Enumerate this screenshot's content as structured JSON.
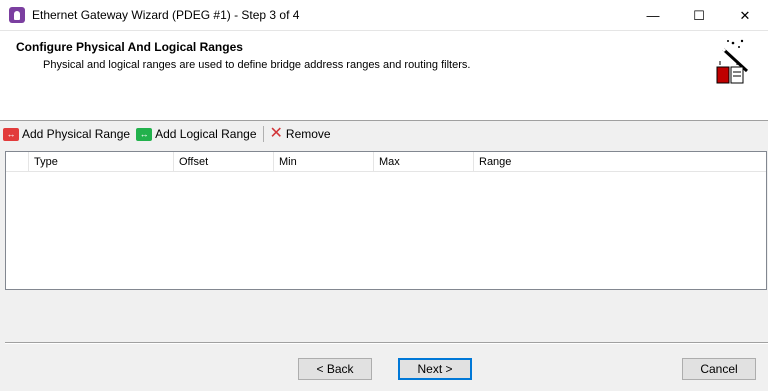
{
  "window": {
    "title": "Ethernet Gateway Wizard (PDEG #1) - Step 3 of 4",
    "minimize_glyph": "—",
    "maximize_glyph": "☐",
    "close_glyph": "✕"
  },
  "header": {
    "title": "Configure Physical And Logical Ranges",
    "description": "Physical and logical ranges are used to define bridge address ranges and routing filters.",
    "icon": "wizard-wand-icon"
  },
  "toolbar": {
    "add_physical_label": "Add Physical Range",
    "add_logical_label": "Add Logical Range",
    "remove_label": "Remove",
    "add_physical_icon": "range-arrow-red-icon",
    "add_logical_icon": "range-arrow-green-icon",
    "remove_icon": "red-x-icon",
    "icon_glyph": "↔",
    "remove_glyph": "✕"
  },
  "grid": {
    "columns": [
      "Type",
      "Offset",
      "Min",
      "Max",
      "Range"
    ],
    "rows": []
  },
  "buttons": {
    "back": "< Back",
    "next": "Next >",
    "cancel": "Cancel"
  },
  "colors": {
    "title_icon": "#7b3fa0",
    "physical_icon": "#e23b3b",
    "logical_icon": "#22b14c",
    "remove_icon": "#d13438",
    "default_button_border": "#0078d7"
  }
}
